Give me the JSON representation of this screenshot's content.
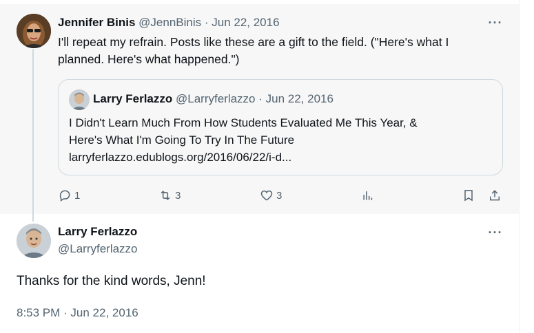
{
  "parent_tweet": {
    "author_name": "Jennifer Binis",
    "handle": "@JennBinis",
    "date": "· Jun 22, 2016",
    "text_line1": "I'll repeat my refrain. Posts like these are a gift to the field. (\"Here's what I",
    "text_line2": "planned. Here's what happened.\")",
    "more_icon": "more-icon",
    "quoted": {
      "author_name": "Larry Ferlazzo",
      "handle": "@Larryferlazzo",
      "date": "· Jun 22, 2016",
      "line1": "I Didn't Learn Much From How Students Evaluated Me This Year, &",
      "line2": "Here's What I'm Going To Try In The  Future",
      "link": "larryferlazzo.edublogs.org/2016/06/22/i-d..."
    },
    "actions": {
      "replies": "1",
      "reposts": "3",
      "likes": "3"
    }
  },
  "main_tweet": {
    "author_name": "Larry Ferlazzo",
    "handle": "@Larryferlazzo",
    "text": "Thanks for the kind words, Jenn!",
    "timestamp": "8:53 PM · Jun 22, 2016"
  },
  "colors": {
    "muted": "#536471",
    "text": "#0f1419",
    "border": "#cfd9de",
    "parent_bg": "#f7f7f7"
  }
}
